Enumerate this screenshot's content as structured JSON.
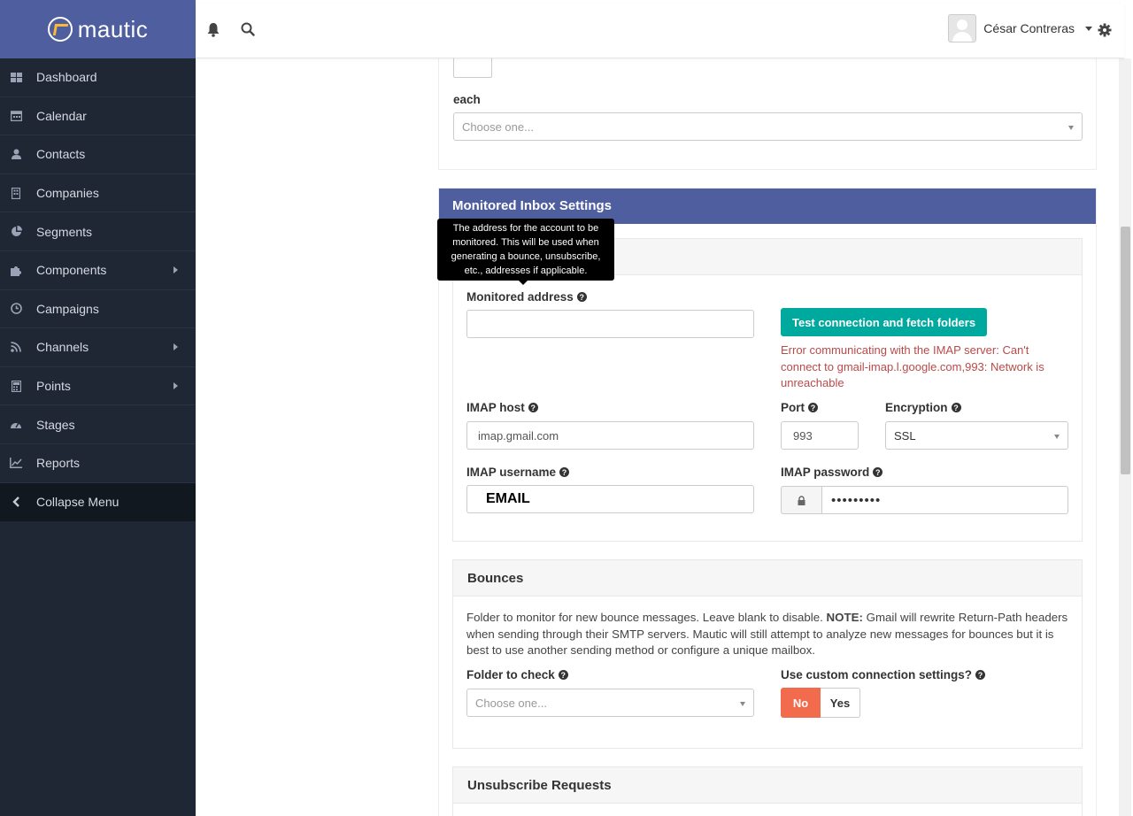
{
  "brand": {
    "name": "mautic"
  },
  "sidebar": {
    "items": [
      {
        "label": "Dashboard",
        "icon": "dashboard-icon",
        "submenu": false
      },
      {
        "label": "Calendar",
        "icon": "calendar-icon",
        "submenu": false
      },
      {
        "label": "Contacts",
        "icon": "user-icon",
        "submenu": false
      },
      {
        "label": "Companies",
        "icon": "building-icon",
        "submenu": false
      },
      {
        "label": "Segments",
        "icon": "pie-chart-icon",
        "submenu": false
      },
      {
        "label": "Components",
        "icon": "puzzle-icon",
        "submenu": true
      },
      {
        "label": "Campaigns",
        "icon": "clock-icon",
        "submenu": false
      },
      {
        "label": "Channels",
        "icon": "rss-icon",
        "submenu": true
      },
      {
        "label": "Points",
        "icon": "calculator-icon",
        "submenu": true
      },
      {
        "label": "Stages",
        "icon": "tachometer-icon",
        "submenu": false
      },
      {
        "label": "Reports",
        "icon": "line-chart-icon",
        "submenu": false
      }
    ],
    "collapse_label": "Collapse Menu"
  },
  "topbar": {
    "user_name": "César Contreras"
  },
  "form_top": {
    "each_label": "each",
    "each_placeholder": "Choose one..."
  },
  "monitored": {
    "title": "Monitored Inbox Settings",
    "tooltip": "The address for the account to be monitored. This will be used when generating a bounce, unsubscribe, etc., addresses if applicable.",
    "address_label": "Monitored address",
    "address_value": "",
    "test_button": "Test connection and fetch folders",
    "error": "Error communicating with the IMAP server: Can't connect to gmail-imap.l.google.com,993: Network is unreachable",
    "host_label": "IMAP host",
    "host_value": "imap.gmail.com",
    "port_label": "Port",
    "port_value": "993",
    "encryption_label": "Encryption",
    "encryption_value": "SSL",
    "username_label": "IMAP username",
    "username_value": "EMAIL",
    "password_label": "IMAP password",
    "password_value": "•••••••••"
  },
  "bounces": {
    "title": "Bounces",
    "desc_before": "Folder to monitor for new bounce messages. Leave blank to disable. ",
    "desc_note": "NOTE:",
    "desc_after": " Gmail will rewrite Return-Path headers when sending through their SMTP servers. Mautic will still attempt to analyze new messages for bounces but it is best to use another sending method or configure a unique mailbox.",
    "folder_label": "Folder to check",
    "folder_placeholder": "Choose one...",
    "custom_label": "Use custom connection settings?",
    "no_label": "No",
    "yes_label": "Yes"
  },
  "unsubscribe": {
    "title": "Unsubscribe Requests"
  }
}
